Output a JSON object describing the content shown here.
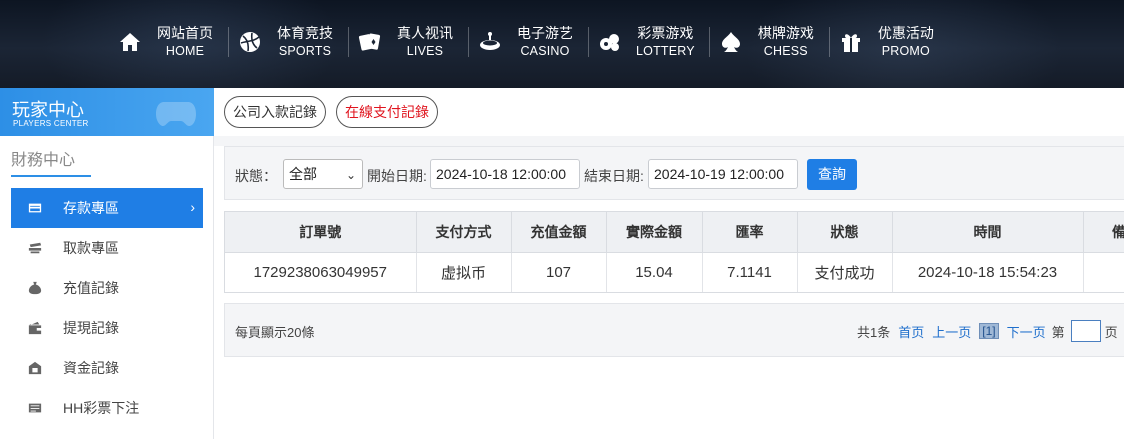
{
  "nav": {
    "items": [
      {
        "cn": "网站首页",
        "en": "HOME",
        "icon": "home-icon"
      },
      {
        "cn": "体育竞技",
        "en": "SPORTS",
        "icon": "ball-icon"
      },
      {
        "cn": "真人视讯",
        "en": "LIVES",
        "icon": "cards-icon"
      },
      {
        "cn": "电子游艺",
        "en": "CASINO",
        "icon": "slot-icon"
      },
      {
        "cn": "彩票游戏",
        "en": "LOTTERY",
        "icon": "lottery-balls-icon"
      },
      {
        "cn": "棋牌游戏",
        "en": "CHESS",
        "icon": "spade-icon"
      },
      {
        "cn": "优惠活动",
        "en": "PROMO",
        "icon": "gift-icon"
      }
    ]
  },
  "sidebar": {
    "title_cn": "玩家中心",
    "title_en": "PLAYERS CENTER",
    "section": "財務中心",
    "items": [
      {
        "label": "存款專區",
        "icon": "card-icon",
        "active": true
      },
      {
        "label": "取款專區",
        "icon": "cash-icon"
      },
      {
        "label": "充值記錄",
        "icon": "money-bag-icon"
      },
      {
        "label": "提現記錄",
        "icon": "wallet-icon"
      },
      {
        "label": "資金記錄",
        "icon": "safe-icon"
      },
      {
        "label": "HH彩票下注",
        "icon": "ticket-icon"
      }
    ]
  },
  "tabs": {
    "company": "公司入款記錄",
    "online": "在線支付記錄"
  },
  "filter": {
    "status_label": "狀態：",
    "status_value": "全部",
    "start_label": "開始日期:",
    "start_value": "2024-10-18 12:00:00",
    "end_label": "結束日期:",
    "end_value": "2024-10-19 12:00:00",
    "query_button": "查詢"
  },
  "table": {
    "headers": [
      "訂單號",
      "支付方式",
      "充值金額",
      "實際金額",
      "匯率",
      "狀態",
      "時間",
      "備"
    ],
    "rows": [
      [
        "1729238063049957",
        "虚拟币",
        "107",
        "15.04",
        "7.1141",
        "支付成功",
        "2024-10-18 15:54:23",
        ""
      ]
    ]
  },
  "pager": {
    "per_page": "每頁顯示20條",
    "total": "共1条",
    "first": "首页",
    "prev": "上一页",
    "current": "[1]",
    "next": "下一页",
    "page_label": "第",
    "page_suffix": "页"
  },
  "colors": {
    "accent": "#1f7ee5",
    "online_tab_text": "#e0141e",
    "nav_bg": "#141b27"
  }
}
